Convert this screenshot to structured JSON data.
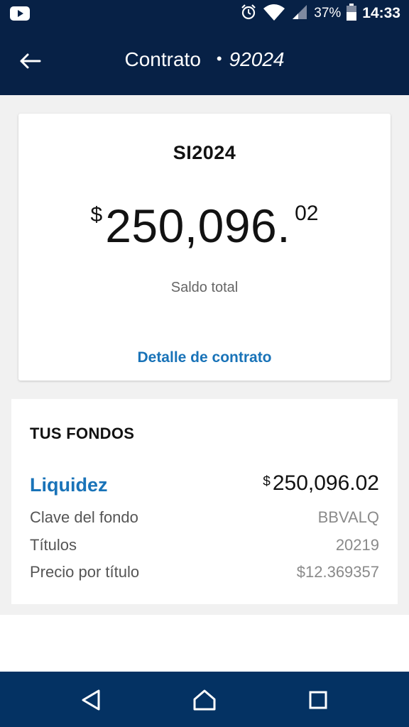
{
  "status_bar": {
    "battery": "37%",
    "time": "14:33"
  },
  "header": {
    "title": "Contrato",
    "contract_number": "92024"
  },
  "balance_card": {
    "title": "SI2024",
    "currency_symbol": "$",
    "amount_integer": "250,096.",
    "amount_decimal": "02",
    "label": "Saldo total",
    "detail_link": "Detalle de contrato"
  },
  "funds": {
    "title": "TUS FONDOS",
    "fund_name": "Liquidez",
    "fund_currency": "$",
    "fund_amount": "250,096.02",
    "rows": [
      {
        "label": "Clave del fondo",
        "value": "BBVALQ"
      },
      {
        "label": "Títulos",
        "value": "20219"
      },
      {
        "label": "Precio por título",
        "value": "$12.369357"
      }
    ]
  },
  "colors": {
    "header_bg": "#072146",
    "nav_bg": "#043263",
    "link": "#1973b8",
    "content_bg": "#f1f1f1"
  },
  "icons": {
    "status_left": "youtube-icon",
    "status_right": [
      "alarm-icon",
      "wifi-icon",
      "signal-icon",
      "battery-icon"
    ],
    "header": "back-arrow-icon",
    "nav": [
      "nav-back-icon",
      "nav-home-icon",
      "nav-recents-icon"
    ]
  }
}
